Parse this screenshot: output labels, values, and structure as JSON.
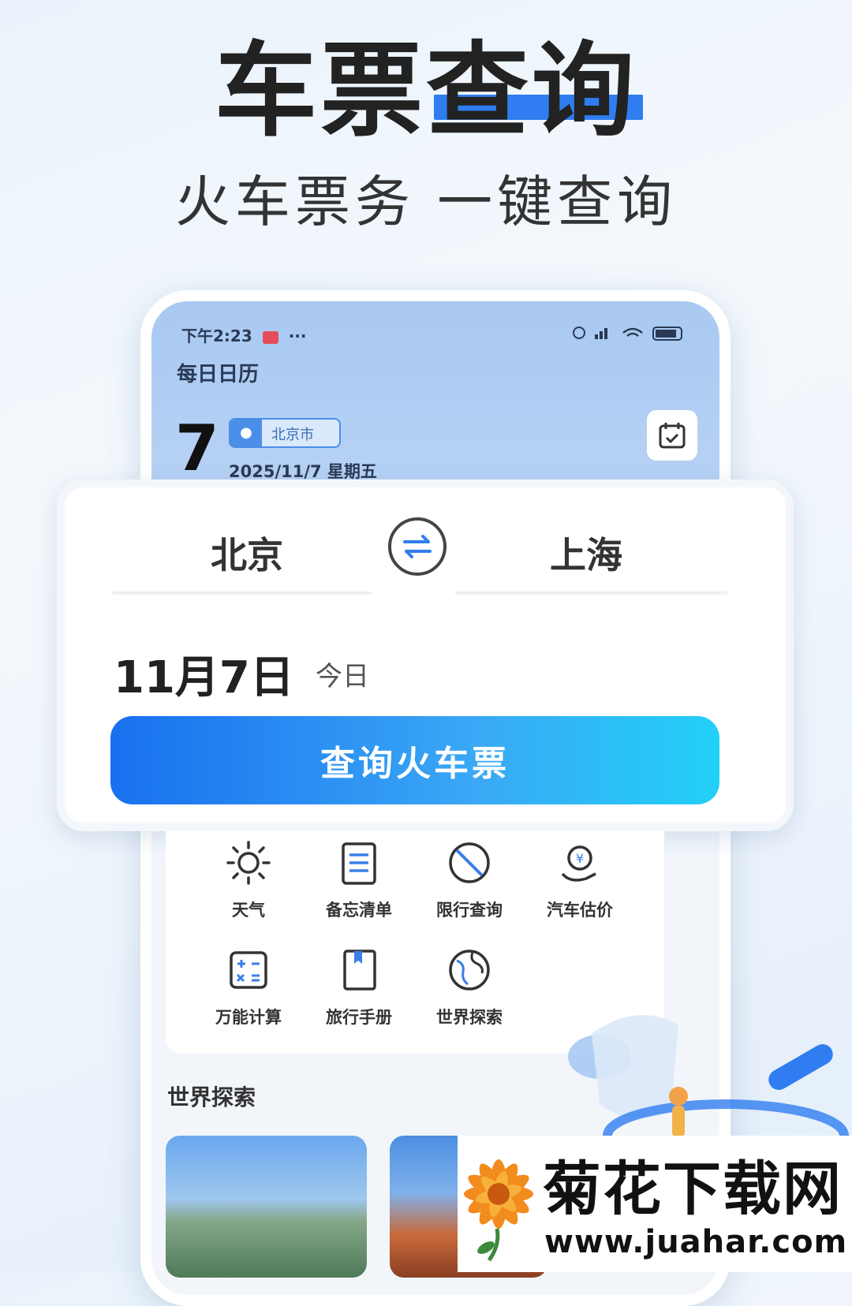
{
  "headline": "车票查询",
  "subline": "火车票务  一键查询",
  "phone": {
    "status_time": "下午2:23",
    "status_dots": "···",
    "calendar_title": "每日日历",
    "calendar_day": "7",
    "location": "北京市",
    "calendar_date": "2025/11/7 星期五"
  },
  "search": {
    "from_city": "北京",
    "to_city": "上海",
    "date": "11月7日",
    "date_hint": "今日",
    "query_label": "查询火车票"
  },
  "tools": [
    {
      "label": "天气",
      "icon": "sun-icon"
    },
    {
      "label": "备忘清单",
      "icon": "notepad-icon"
    },
    {
      "label": "限行查询",
      "icon": "no-entry-icon"
    },
    {
      "label": "汽车估价",
      "icon": "car-price-icon"
    },
    {
      "label": "万能计算",
      "icon": "calculator-icon"
    },
    {
      "label": "旅行手册",
      "icon": "book-icon"
    },
    {
      "label": "世界探索",
      "icon": "globe-icon"
    }
  ],
  "section_title": "世界探索",
  "watermark": {
    "name": "菊花下载网",
    "url": "www.juahar.com"
  },
  "colors": {
    "accent": "#2f7df0",
    "button_start": "#1870ef",
    "button_end": "#22d0f7"
  }
}
